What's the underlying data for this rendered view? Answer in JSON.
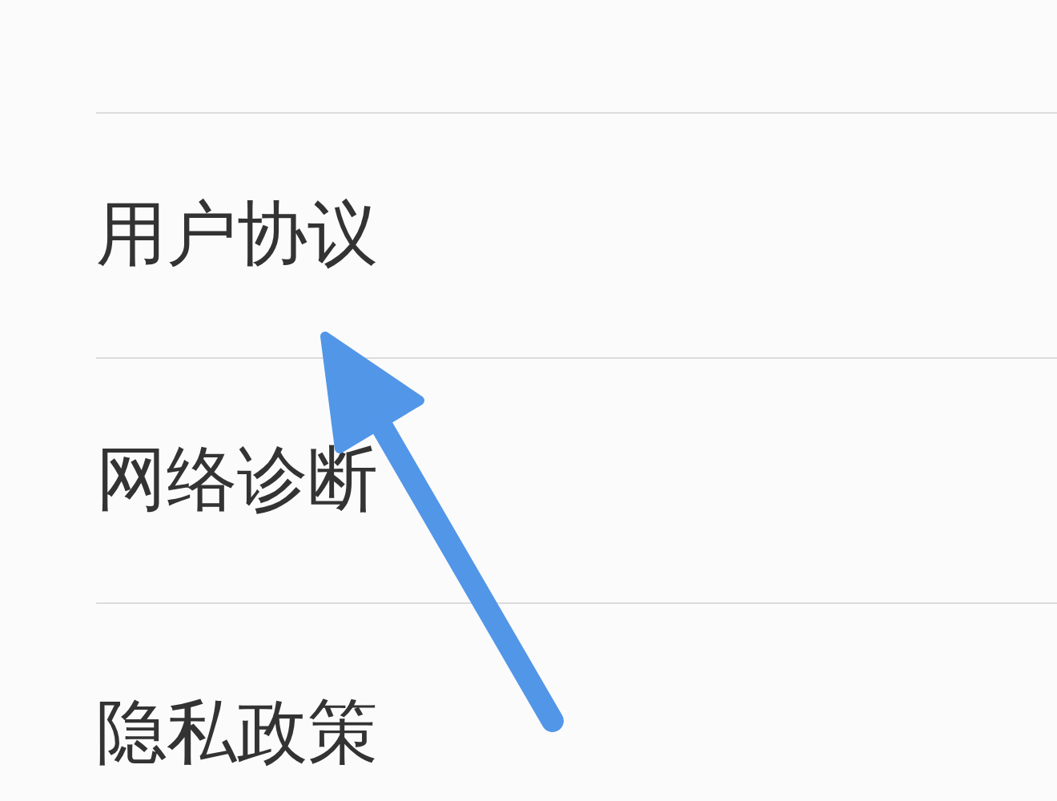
{
  "settings_list": {
    "items": [
      {
        "label": "用户协议"
      },
      {
        "label": "网络诊断"
      },
      {
        "label": "隐私政策"
      }
    ]
  }
}
